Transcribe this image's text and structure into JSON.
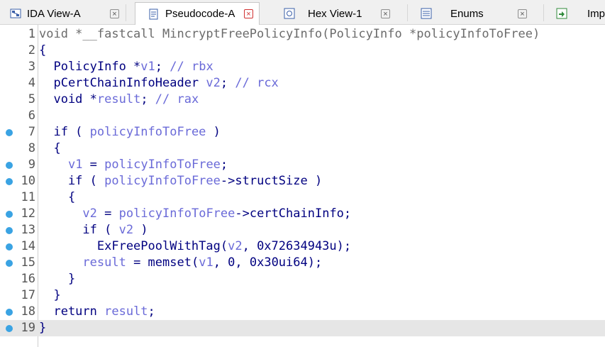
{
  "tabs": [
    {
      "label": "IDA View-A",
      "icon": "ida-view-icon",
      "active": false
    },
    {
      "label": "Pseudocode-A",
      "icon": "pseudocode-icon",
      "active": true
    },
    {
      "label": "Hex View-1",
      "icon": "hex-view-icon",
      "active": false
    },
    {
      "label": "Enums",
      "icon": "enums-icon",
      "active": false
    },
    {
      "label": "Imp",
      "icon": "imports-icon",
      "active": false
    }
  ],
  "close_glyph": "×",
  "colors": {
    "breakpoint": "#3aa3e3",
    "keyword": "#000080",
    "variable": "#6a6ad8",
    "current_line": "#e6e6e6"
  },
  "code_lines": [
    {
      "num": "1",
      "bp": false,
      "text": "void *__fastcall MincryptFreePolicyInfo(PolicyInfo *policyInfoToFree)"
    },
    {
      "num": "2",
      "bp": false,
      "text": "{"
    },
    {
      "num": "3",
      "bp": false,
      "text": "  PolicyInfo *v1; // rbx"
    },
    {
      "num": "4",
      "bp": false,
      "text": "  pCertChainInfoHeader v2; // rcx"
    },
    {
      "num": "5",
      "bp": false,
      "text": "  void *result; // rax"
    },
    {
      "num": "6",
      "bp": false,
      "text": ""
    },
    {
      "num": "7",
      "bp": true,
      "text": "  if ( policyInfoToFree )"
    },
    {
      "num": "8",
      "bp": false,
      "text": "  {"
    },
    {
      "num": "9",
      "bp": true,
      "text": "    v1 = policyInfoToFree;"
    },
    {
      "num": "10",
      "bp": true,
      "text": "    if ( policyInfoToFree->structSize )"
    },
    {
      "num": "11",
      "bp": false,
      "text": "    {"
    },
    {
      "num": "12",
      "bp": true,
      "text": "      v2 = policyInfoToFree->certChainInfo;"
    },
    {
      "num": "13",
      "bp": true,
      "text": "      if ( v2 )"
    },
    {
      "num": "14",
      "bp": true,
      "text": "        ExFreePoolWithTag(v2, 0x72634943u);"
    },
    {
      "num": "15",
      "bp": true,
      "text": "      result = memset(v1, 0, 0x30ui64);"
    },
    {
      "num": "16",
      "bp": false,
      "text": "    }"
    },
    {
      "num": "17",
      "bp": false,
      "text": "  }"
    },
    {
      "num": "18",
      "bp": true,
      "text": "  return result;"
    },
    {
      "num": "19",
      "bp": true,
      "text": "}",
      "current": true
    }
  ]
}
